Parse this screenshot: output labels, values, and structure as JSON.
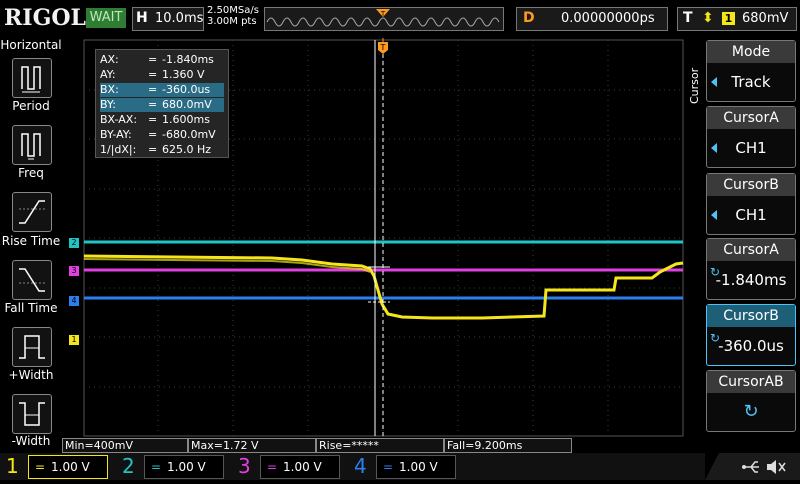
{
  "top": {
    "logo": "RIGOL",
    "status": "WAIT",
    "h_label": "H",
    "timebase": "10.0ms",
    "sample_rate": "2.50MSa/s",
    "points": "3.00M pts",
    "d_label": "D",
    "delay": "0.00000000ps",
    "t_label": "T",
    "trigger_channel": "1",
    "trigger_level": "680mV"
  },
  "left_menu": {
    "title": "Horizontal",
    "items": [
      {
        "label": "Period",
        "icon": "period-icon"
      },
      {
        "label": "Freq",
        "icon": "freq-icon"
      },
      {
        "label": "Rise Time",
        "icon": "rise-time-icon"
      },
      {
        "label": "Fall Time",
        "icon": "fall-time-icon"
      },
      {
        "label": "+Width",
        "icon": "pos-width-icon"
      },
      {
        "label": "-Width",
        "icon": "neg-width-icon"
      }
    ]
  },
  "cursor_info": [
    {
      "key": "AX:",
      "eq": "=",
      "value": "-1.840ms"
    },
    {
      "key": "AY:",
      "eq": "=",
      "value": "1.360 V"
    },
    {
      "key": "BX:",
      "eq": "=",
      "value": "-360.0us"
    },
    {
      "key": "BY:",
      "eq": "=",
      "value": "680.0mV"
    },
    {
      "key": "BX-AX:",
      "eq": "=",
      "value": "1.600ms"
    },
    {
      "key": "BY-AY:",
      "eq": "=",
      "value": "-680.0mV"
    },
    {
      "key": "1/|dX|:",
      "eq": "=",
      "value": "625.0 Hz"
    }
  ],
  "right_menu": {
    "section": "Cursor",
    "buttons": [
      {
        "title": "Mode",
        "value": "Track"
      },
      {
        "title": "CursorA",
        "value": "CH1"
      },
      {
        "title": "CursorB",
        "value": "CH1"
      },
      {
        "title": "CursorA",
        "value": "-1.840ms"
      },
      {
        "title": "CursorB",
        "value": "-360.0us"
      },
      {
        "title": "CursorAB",
        "value": ""
      }
    ]
  },
  "measurements": {
    "min": "Min=400mV",
    "max": "Max=1.72 V",
    "rise": "Rise=*****",
    "fall": "Fall=9.200ms"
  },
  "channels": [
    {
      "num": "1",
      "coupling": "=",
      "scale": "1.00 V",
      "color": "#f5e61b"
    },
    {
      "num": "2",
      "coupling": "=",
      "scale": "1.00 V",
      "color": "#21c4c6"
    },
    {
      "num": "3",
      "coupling": "=",
      "scale": "1.00 V",
      "color": "#e040e0"
    },
    {
      "num": "4",
      "coupling": "=",
      "scale": "1.00 V",
      "color": "#2d7ff0"
    }
  ],
  "markers": {
    "ch1": "1",
    "ch2": "2",
    "ch3": "3",
    "ch4": "4",
    "trigger": "T"
  },
  "colors": {
    "ch1": "#f5e61b",
    "ch2": "#21c4c6",
    "ch3": "#e040e0",
    "ch4": "#2d7ff0",
    "trigger": "#ff9a1f",
    "accent": "#4fc3f7"
  }
}
